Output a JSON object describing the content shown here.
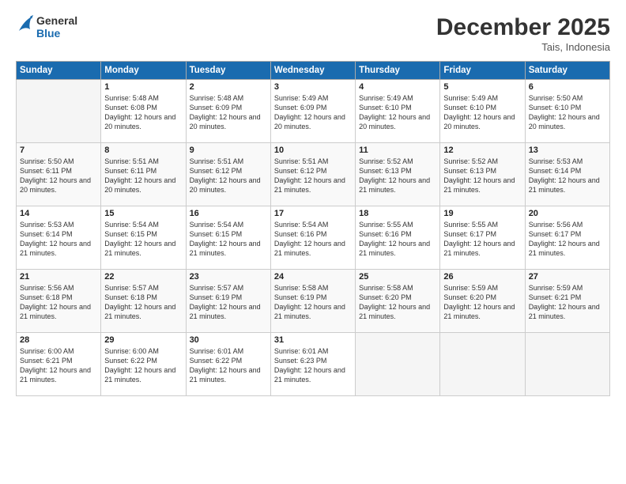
{
  "logo": {
    "line1": "General",
    "line2": "Blue"
  },
  "title": "December 2025",
  "subtitle": "Tais, Indonesia",
  "header_days": [
    "Sunday",
    "Monday",
    "Tuesday",
    "Wednesday",
    "Thursday",
    "Friday",
    "Saturday"
  ],
  "weeks": [
    [
      {
        "day": "",
        "sunrise": "",
        "sunset": "",
        "daylight": ""
      },
      {
        "day": "1",
        "sunrise": "Sunrise: 5:48 AM",
        "sunset": "Sunset: 6:08 PM",
        "daylight": "Daylight: 12 hours and 20 minutes."
      },
      {
        "day": "2",
        "sunrise": "Sunrise: 5:48 AM",
        "sunset": "Sunset: 6:09 PM",
        "daylight": "Daylight: 12 hours and 20 minutes."
      },
      {
        "day": "3",
        "sunrise": "Sunrise: 5:49 AM",
        "sunset": "Sunset: 6:09 PM",
        "daylight": "Daylight: 12 hours and 20 minutes."
      },
      {
        "day": "4",
        "sunrise": "Sunrise: 5:49 AM",
        "sunset": "Sunset: 6:10 PM",
        "daylight": "Daylight: 12 hours and 20 minutes."
      },
      {
        "day": "5",
        "sunrise": "Sunrise: 5:49 AM",
        "sunset": "Sunset: 6:10 PM",
        "daylight": "Daylight: 12 hours and 20 minutes."
      },
      {
        "day": "6",
        "sunrise": "Sunrise: 5:50 AM",
        "sunset": "Sunset: 6:10 PM",
        "daylight": "Daylight: 12 hours and 20 minutes."
      }
    ],
    [
      {
        "day": "7",
        "sunrise": "Sunrise: 5:50 AM",
        "sunset": "Sunset: 6:11 PM",
        "daylight": "Daylight: 12 hours and 20 minutes."
      },
      {
        "day": "8",
        "sunrise": "Sunrise: 5:51 AM",
        "sunset": "Sunset: 6:11 PM",
        "daylight": "Daylight: 12 hours and 20 minutes."
      },
      {
        "day": "9",
        "sunrise": "Sunrise: 5:51 AM",
        "sunset": "Sunset: 6:12 PM",
        "daylight": "Daylight: 12 hours and 20 minutes."
      },
      {
        "day": "10",
        "sunrise": "Sunrise: 5:51 AM",
        "sunset": "Sunset: 6:12 PM",
        "daylight": "Daylight: 12 hours and 21 minutes."
      },
      {
        "day": "11",
        "sunrise": "Sunrise: 5:52 AM",
        "sunset": "Sunset: 6:13 PM",
        "daylight": "Daylight: 12 hours and 21 minutes."
      },
      {
        "day": "12",
        "sunrise": "Sunrise: 5:52 AM",
        "sunset": "Sunset: 6:13 PM",
        "daylight": "Daylight: 12 hours and 21 minutes."
      },
      {
        "day": "13",
        "sunrise": "Sunrise: 5:53 AM",
        "sunset": "Sunset: 6:14 PM",
        "daylight": "Daylight: 12 hours and 21 minutes."
      }
    ],
    [
      {
        "day": "14",
        "sunrise": "Sunrise: 5:53 AM",
        "sunset": "Sunset: 6:14 PM",
        "daylight": "Daylight: 12 hours and 21 minutes."
      },
      {
        "day": "15",
        "sunrise": "Sunrise: 5:54 AM",
        "sunset": "Sunset: 6:15 PM",
        "daylight": "Daylight: 12 hours and 21 minutes."
      },
      {
        "day": "16",
        "sunrise": "Sunrise: 5:54 AM",
        "sunset": "Sunset: 6:15 PM",
        "daylight": "Daylight: 12 hours and 21 minutes."
      },
      {
        "day": "17",
        "sunrise": "Sunrise: 5:54 AM",
        "sunset": "Sunset: 6:16 PM",
        "daylight": "Daylight: 12 hours and 21 minutes."
      },
      {
        "day": "18",
        "sunrise": "Sunrise: 5:55 AM",
        "sunset": "Sunset: 6:16 PM",
        "daylight": "Daylight: 12 hours and 21 minutes."
      },
      {
        "day": "19",
        "sunrise": "Sunrise: 5:55 AM",
        "sunset": "Sunset: 6:17 PM",
        "daylight": "Daylight: 12 hours and 21 minutes."
      },
      {
        "day": "20",
        "sunrise": "Sunrise: 5:56 AM",
        "sunset": "Sunset: 6:17 PM",
        "daylight": "Daylight: 12 hours and 21 minutes."
      }
    ],
    [
      {
        "day": "21",
        "sunrise": "Sunrise: 5:56 AM",
        "sunset": "Sunset: 6:18 PM",
        "daylight": "Daylight: 12 hours and 21 minutes."
      },
      {
        "day": "22",
        "sunrise": "Sunrise: 5:57 AM",
        "sunset": "Sunset: 6:18 PM",
        "daylight": "Daylight: 12 hours and 21 minutes."
      },
      {
        "day": "23",
        "sunrise": "Sunrise: 5:57 AM",
        "sunset": "Sunset: 6:19 PM",
        "daylight": "Daylight: 12 hours and 21 minutes."
      },
      {
        "day": "24",
        "sunrise": "Sunrise: 5:58 AM",
        "sunset": "Sunset: 6:19 PM",
        "daylight": "Daylight: 12 hours and 21 minutes."
      },
      {
        "day": "25",
        "sunrise": "Sunrise: 5:58 AM",
        "sunset": "Sunset: 6:20 PM",
        "daylight": "Daylight: 12 hours and 21 minutes."
      },
      {
        "day": "26",
        "sunrise": "Sunrise: 5:59 AM",
        "sunset": "Sunset: 6:20 PM",
        "daylight": "Daylight: 12 hours and 21 minutes."
      },
      {
        "day": "27",
        "sunrise": "Sunrise: 5:59 AM",
        "sunset": "Sunset: 6:21 PM",
        "daylight": "Daylight: 12 hours and 21 minutes."
      }
    ],
    [
      {
        "day": "28",
        "sunrise": "Sunrise: 6:00 AM",
        "sunset": "Sunset: 6:21 PM",
        "daylight": "Daylight: 12 hours and 21 minutes."
      },
      {
        "day": "29",
        "sunrise": "Sunrise: 6:00 AM",
        "sunset": "Sunset: 6:22 PM",
        "daylight": "Daylight: 12 hours and 21 minutes."
      },
      {
        "day": "30",
        "sunrise": "Sunrise: 6:01 AM",
        "sunset": "Sunset: 6:22 PM",
        "daylight": "Daylight: 12 hours and 21 minutes."
      },
      {
        "day": "31",
        "sunrise": "Sunrise: 6:01 AM",
        "sunset": "Sunset: 6:23 PM",
        "daylight": "Daylight: 12 hours and 21 minutes."
      },
      {
        "day": "",
        "sunrise": "",
        "sunset": "",
        "daylight": ""
      },
      {
        "day": "",
        "sunrise": "",
        "sunset": "",
        "daylight": ""
      },
      {
        "day": "",
        "sunrise": "",
        "sunset": "",
        "daylight": ""
      }
    ]
  ]
}
